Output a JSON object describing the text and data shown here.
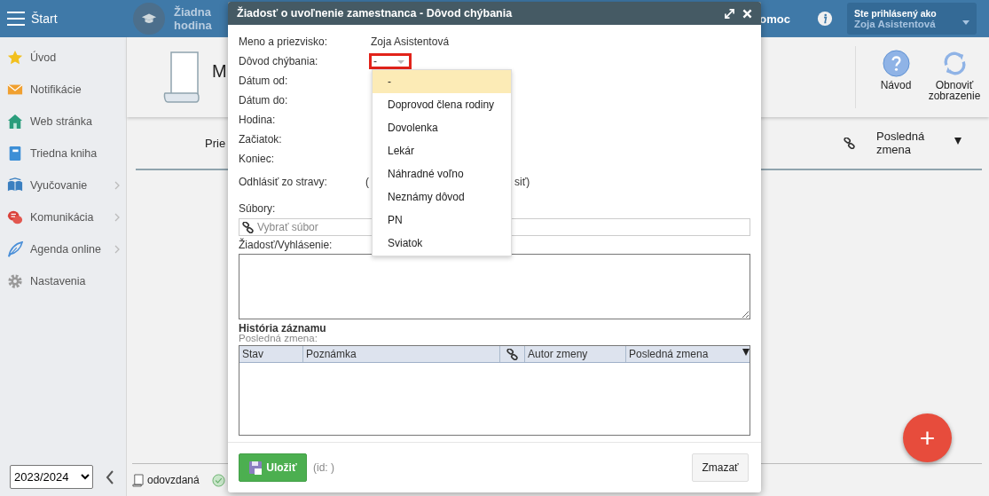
{
  "top_bar": {
    "title": "Štart",
    "lesson": "Žiadna hodina",
    "help_fragment": "omoc",
    "user": {
      "caption": "Ste prihlásený ako",
      "name": "Zoja Asistentová"
    }
  },
  "sidebar": {
    "items": [
      {
        "label": "Úvod",
        "kind": "star",
        "has_submenu": false
      },
      {
        "label": "Notifikácie",
        "kind": "mail",
        "has_submenu": false
      },
      {
        "label": "Web stránka",
        "kind": "house",
        "has_submenu": false
      },
      {
        "label": "Triedna kniha",
        "kind": "notebook",
        "has_submenu": false
      },
      {
        "label": "Vyučovanie",
        "kind": "book",
        "has_submenu": true
      },
      {
        "label": "Komunikácia",
        "kind": "chat",
        "has_submenu": true
      },
      {
        "label": "Agenda online",
        "kind": "pen",
        "has_submenu": true
      },
      {
        "label": "Nastavenia",
        "kind": "gear",
        "has_submenu": false
      }
    ],
    "school_year": "2023/2024"
  },
  "page": {
    "title_fragment": "M",
    "toolbar": [
      {
        "label": "Návod",
        "kind": "help"
      },
      {
        "label": "Obnoviť zobrazenie",
        "kind": "refresh"
      }
    ],
    "columns": [
      {
        "label": "Prie",
        "kind": "text",
        "sorted": false
      },
      {
        "kind": "link"
      },
      {
        "label": "Posledná zmena",
        "kind": "text",
        "sorted": true
      }
    ],
    "legend": [
      {
        "kind": "paper",
        "label": "odovzdaná"
      },
      {
        "kind": "check"
      }
    ]
  },
  "dialog": {
    "title": "Žiadosť o uvoľnenie zamestnanca - Dôvod chýbania",
    "fields": [
      {
        "label": "Meno a priezvisko:",
        "kind": "text",
        "value": "Zoja Asistentová"
      },
      {
        "label": "Dôvod chýbania:",
        "kind": "select",
        "value": "-",
        "invalid": true
      },
      {
        "label": "Dátum od:",
        "kind": "blank"
      },
      {
        "label": "Dátum do:",
        "kind": "blank"
      },
      {
        "label": "Hodina:",
        "kind": "blank"
      },
      {
        "label": "Začiatok:",
        "kind": "blank"
      },
      {
        "label": "Koniec:",
        "kind": "blank"
      },
      {
        "label": "Odhlásiť zo stravy:",
        "kind": "partial",
        "before": "(",
        "after": "siť)"
      }
    ],
    "files": {
      "label": "Súbory:",
      "placeholder": "Vybrať súbor"
    },
    "request": {
      "label": "Žiadosť/Vyhlásenie:"
    },
    "history": {
      "title": "História záznamu",
      "subtitle": "Posledná zmena:",
      "columns": [
        {
          "kind": "text",
          "label": "Stav",
          "sorted": false
        },
        {
          "kind": "text",
          "label": "Poznámka",
          "sorted": false
        },
        {
          "kind": "link"
        },
        {
          "kind": "text",
          "label": "Autor zmeny",
          "sorted": false
        },
        {
          "kind": "text",
          "label": "Posledná zmena",
          "sorted": true
        }
      ]
    },
    "dropdown": {
      "options": [
        {
          "label": "-",
          "selected": true
        },
        {
          "label": "Doprovod člena rodiny",
          "selected": false
        },
        {
          "label": "Dovolenka",
          "selected": false
        },
        {
          "label": "Lekár",
          "selected": false
        },
        {
          "label": "Náhradné voľno",
          "selected": false
        },
        {
          "label": "Neznámy dôvod",
          "selected": false
        },
        {
          "label": "PN",
          "selected": false
        },
        {
          "label": "Sviatok",
          "selected": false
        }
      ]
    },
    "footer": {
      "save": "Uložiť",
      "id": "(id: )",
      "delete": "Zmazať"
    }
  },
  "fab": {
    "label": "+"
  }
}
